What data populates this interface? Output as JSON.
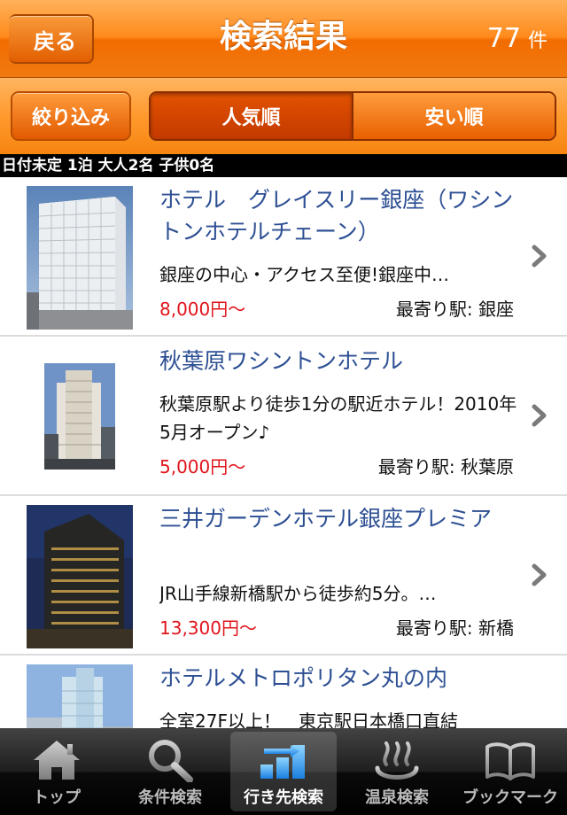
{
  "header": {
    "back_label": "戻る",
    "title": "検索結果",
    "count": "77",
    "count_unit": "件"
  },
  "filter": {
    "refine_label": "絞り込み",
    "sort_options": [
      "人気順",
      "安い順"
    ],
    "active_sort": "人気順"
  },
  "conditions": "日付未定 1泊 大人2名 子供0名",
  "hotels": [
    {
      "name": "ホテル　グレイスリー銀座（ワシントンホテルチェーン）",
      "description": "銀座の中心・アクセス至便!銀座中…",
      "price": "8,000円～",
      "station": "最寄り駅: 銀座"
    },
    {
      "name": "秋葉原ワシントンホテル",
      "description": "秋葉原駅より徒歩1分の駅近ホテル！2010年5月オープン♪",
      "price": "5,000円～",
      "station": "最寄り駅: 秋葉原"
    },
    {
      "name": "三井ガーデンホテル銀座プレミア",
      "description": "JR山手線新橋駅から徒歩約5分。…",
      "price": "13,300円～",
      "station": "最寄り駅: 新橋"
    },
    {
      "name": "ホテルメトロポリタン丸の内",
      "description": "全室27F以上！　東京駅日本橋口直結",
      "price": "",
      "station": ""
    }
  ],
  "tabs": [
    {
      "label": "トップ",
      "icon": "home-icon"
    },
    {
      "label": "条件検索",
      "icon": "search-icon"
    },
    {
      "label": "行き先検索",
      "icon": "destination-icon"
    },
    {
      "label": "温泉検索",
      "icon": "hot-spring-icon"
    },
    {
      "label": "ブックマーク",
      "icon": "bookmark-icon"
    }
  ],
  "active_tab": "行き先検索",
  "colors": {
    "header_orange": "#f07a10",
    "hotel_name_blue": "#2d4f93",
    "price_red": "#e0141b",
    "tabbar_black": "#000000"
  }
}
